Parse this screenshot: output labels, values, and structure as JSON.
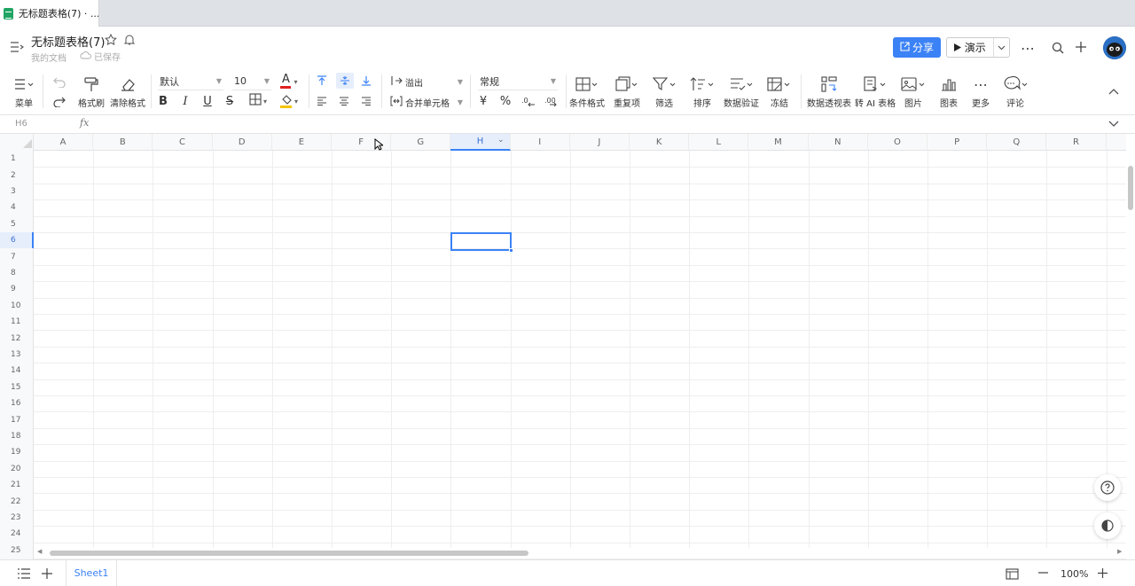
{
  "browser": {
    "tab_title": "无标题表格(7) · ..."
  },
  "header": {
    "title": "无标题表格(7)",
    "location": "我的文档",
    "save_status": "已保存",
    "share_label": "分享",
    "present_label": "演示"
  },
  "toolbar": {
    "menu": "菜单",
    "format_painter": "格式刷",
    "clear_format": "清除格式",
    "font_family": "默认",
    "font_size": "10",
    "bold": "B",
    "italic": "I",
    "underline": "U",
    "strike": "S",
    "overflow": "溢出",
    "merge_cells": "合并单元格",
    "number_format": "常规",
    "currency": "¥",
    "percent": "%",
    "conditional_format": "条件格式",
    "duplicates": "重复项",
    "filter": "筛选",
    "sort": "排序",
    "data_validation": "数据验证",
    "freeze": "冻结",
    "pivot_table": "数据透视表",
    "ai_table": "转 AI 表格",
    "image": "图片",
    "chart": "图表",
    "more": "更多",
    "comment": "评论"
  },
  "formula_bar": {
    "cell_ref": "H6",
    "fx": "fx"
  },
  "grid": {
    "columns": [
      "A",
      "B",
      "C",
      "D",
      "E",
      "F",
      "G",
      "H",
      "I",
      "J",
      "K",
      "L",
      "M",
      "N",
      "O",
      "P",
      "Q",
      "R"
    ],
    "rows": [
      "1",
      "2",
      "3",
      "4",
      "5",
      "6",
      "7",
      "8",
      "9",
      "10",
      "11",
      "12",
      "13",
      "14",
      "15",
      "16",
      "17",
      "18",
      "19",
      "20",
      "21",
      "22",
      "23",
      "24",
      "25"
    ],
    "selected_column": "H",
    "selected_row": "6"
  },
  "bottom": {
    "sheet_name": "Sheet1",
    "zoom": "100%"
  },
  "colors": {
    "accent": "#3b82f6",
    "sheet_icon": "#1fa463"
  }
}
